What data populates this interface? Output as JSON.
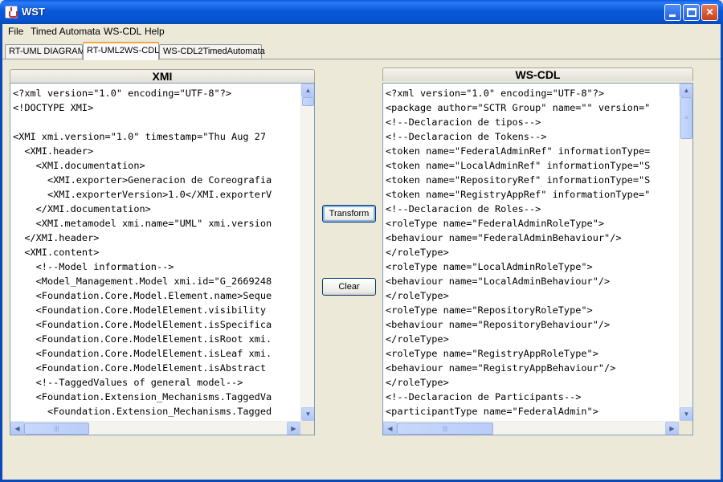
{
  "window": {
    "title": "WST"
  },
  "menu": {
    "items": [
      "File",
      "Timed Automata",
      "WS-CDL",
      "Help"
    ]
  },
  "tabs": [
    {
      "label": "RT-UML DIAGRAM"
    },
    {
      "label": "RT-UML2WS-CDL"
    },
    {
      "label": "WS-CDL2TimedAutomata"
    }
  ],
  "left_panel": {
    "title": "XMI",
    "lines": [
      "<?xml version=\"1.0\" encoding=\"UTF-8\"?>",
      "<!DOCTYPE XMI>",
      "",
      "<XMI xmi.version=\"1.0\" timestamp=\"Thu Aug 27",
      "  <XMI.header>",
      "    <XMI.documentation>",
      "      <XMI.exporter>Generacion de Coreografia",
      "      <XMI.exporterVersion>1.0</XMI.exporterV",
      "    </XMI.documentation>",
      "    <XMI.metamodel xmi.name=\"UML\" xmi.version",
      "  </XMI.header>",
      "  <XMI.content>",
      "    <!--Model information-->",
      "    <Model_Management.Model xmi.id=\"G_2669248",
      "    <Foundation.Core.Model.Element.name>Seque",
      "    <Foundation.Core.ModelElement.visibility",
      "    <Foundation.Core.ModelElement.isSpecifica",
      "    <Foundation.Core.ModelElement.isRoot xmi.",
      "    <Foundation.Core.ModelElement.isLeaf xmi.",
      "    <Foundation.Core.ModelElement.isAbstract",
      "    <!--TaggedValues of general model-->",
      "    <Foundation.Extension_Mechanisms.TaggedVa",
      "      <Foundation.Extension_Mechanisms.Tagged"
    ]
  },
  "right_panel": {
    "title": "WS-CDL",
    "lines": [
      "<?xml version=\"1.0\" encoding=\"UTF-8\"?>",
      "<package author=\"SCTR Group\" name=\"\" version=\"",
      "<!--Declaracion de tipos-->",
      "<!--Declaracion de Tokens-->",
      "<token name=\"FederalAdminRef\" informationType=",
      "<token name=\"LocalAdminRef\" informationType=\"S",
      "<token name=\"RepositoryRef\" informationType=\"S",
      "<token name=\"RegistryAppRef\" informationType=\"",
      "<!--Declaracion de Roles-->",
      "<roleType name=\"FederalAdminRoleType\">",
      "<behaviour name=\"FederalAdminBehaviour\"/>",
      "</roleType>",
      "<roleType name=\"LocalAdminRoleType\">",
      "<behaviour name=\"LocalAdminBehaviour\"/>",
      "</roleType>",
      "<roleType name=\"RepositoryRoleType\">",
      "<behaviour name=\"RepositoryBehaviour\"/>",
      "</roleType>",
      "<roleType name=\"RegistryAppRoleType\">",
      "<behaviour name=\"RegistryAppBehaviour\"/>",
      "</roleType>",
      "<!--Declaracion de Participants-->",
      "<participantType name=\"FederalAdmin\">"
    ]
  },
  "buttons": {
    "transform_label": "Transform",
    "clear_label": "Clear"
  },
  "icons": {
    "app": "java-cup-icon",
    "scroll_up": "▲",
    "scroll_down": "▼",
    "scroll_left": "◀",
    "scroll_right": "▶",
    "grip": "|||"
  }
}
